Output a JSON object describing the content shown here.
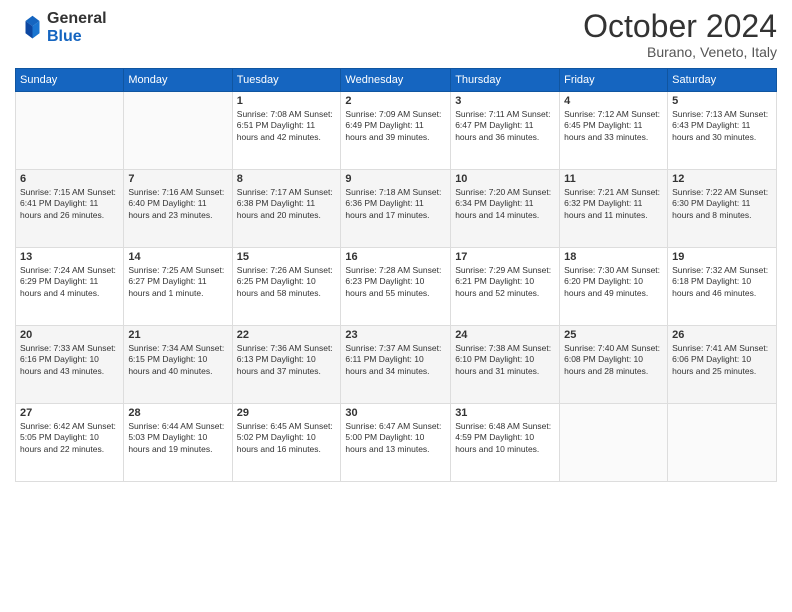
{
  "header": {
    "logo_general": "General",
    "logo_blue": "Blue",
    "month_title": "October 2024",
    "location": "Burano, Veneto, Italy"
  },
  "days_of_week": [
    "Sunday",
    "Monday",
    "Tuesday",
    "Wednesday",
    "Thursday",
    "Friday",
    "Saturday"
  ],
  "weeks": [
    [
      {
        "day": "",
        "info": ""
      },
      {
        "day": "",
        "info": ""
      },
      {
        "day": "1",
        "info": "Sunrise: 7:08 AM\nSunset: 6:51 PM\nDaylight: 11 hours and 42 minutes."
      },
      {
        "day": "2",
        "info": "Sunrise: 7:09 AM\nSunset: 6:49 PM\nDaylight: 11 hours and 39 minutes."
      },
      {
        "day": "3",
        "info": "Sunrise: 7:11 AM\nSunset: 6:47 PM\nDaylight: 11 hours and 36 minutes."
      },
      {
        "day": "4",
        "info": "Sunrise: 7:12 AM\nSunset: 6:45 PM\nDaylight: 11 hours and 33 minutes."
      },
      {
        "day": "5",
        "info": "Sunrise: 7:13 AM\nSunset: 6:43 PM\nDaylight: 11 hours and 30 minutes."
      }
    ],
    [
      {
        "day": "6",
        "info": "Sunrise: 7:15 AM\nSunset: 6:41 PM\nDaylight: 11 hours and 26 minutes."
      },
      {
        "day": "7",
        "info": "Sunrise: 7:16 AM\nSunset: 6:40 PM\nDaylight: 11 hours and 23 minutes."
      },
      {
        "day": "8",
        "info": "Sunrise: 7:17 AM\nSunset: 6:38 PM\nDaylight: 11 hours and 20 minutes."
      },
      {
        "day": "9",
        "info": "Sunrise: 7:18 AM\nSunset: 6:36 PM\nDaylight: 11 hours and 17 minutes."
      },
      {
        "day": "10",
        "info": "Sunrise: 7:20 AM\nSunset: 6:34 PM\nDaylight: 11 hours and 14 minutes."
      },
      {
        "day": "11",
        "info": "Sunrise: 7:21 AM\nSunset: 6:32 PM\nDaylight: 11 hours and 11 minutes."
      },
      {
        "day": "12",
        "info": "Sunrise: 7:22 AM\nSunset: 6:30 PM\nDaylight: 11 hours and 8 minutes."
      }
    ],
    [
      {
        "day": "13",
        "info": "Sunrise: 7:24 AM\nSunset: 6:29 PM\nDaylight: 11 hours and 4 minutes."
      },
      {
        "day": "14",
        "info": "Sunrise: 7:25 AM\nSunset: 6:27 PM\nDaylight: 11 hours and 1 minute."
      },
      {
        "day": "15",
        "info": "Sunrise: 7:26 AM\nSunset: 6:25 PM\nDaylight: 10 hours and 58 minutes."
      },
      {
        "day": "16",
        "info": "Sunrise: 7:28 AM\nSunset: 6:23 PM\nDaylight: 10 hours and 55 minutes."
      },
      {
        "day": "17",
        "info": "Sunrise: 7:29 AM\nSunset: 6:21 PM\nDaylight: 10 hours and 52 minutes."
      },
      {
        "day": "18",
        "info": "Sunrise: 7:30 AM\nSunset: 6:20 PM\nDaylight: 10 hours and 49 minutes."
      },
      {
        "day": "19",
        "info": "Sunrise: 7:32 AM\nSunset: 6:18 PM\nDaylight: 10 hours and 46 minutes."
      }
    ],
    [
      {
        "day": "20",
        "info": "Sunrise: 7:33 AM\nSunset: 6:16 PM\nDaylight: 10 hours and 43 minutes."
      },
      {
        "day": "21",
        "info": "Sunrise: 7:34 AM\nSunset: 6:15 PM\nDaylight: 10 hours and 40 minutes."
      },
      {
        "day": "22",
        "info": "Sunrise: 7:36 AM\nSunset: 6:13 PM\nDaylight: 10 hours and 37 minutes."
      },
      {
        "day": "23",
        "info": "Sunrise: 7:37 AM\nSunset: 6:11 PM\nDaylight: 10 hours and 34 minutes."
      },
      {
        "day": "24",
        "info": "Sunrise: 7:38 AM\nSunset: 6:10 PM\nDaylight: 10 hours and 31 minutes."
      },
      {
        "day": "25",
        "info": "Sunrise: 7:40 AM\nSunset: 6:08 PM\nDaylight: 10 hours and 28 minutes."
      },
      {
        "day": "26",
        "info": "Sunrise: 7:41 AM\nSunset: 6:06 PM\nDaylight: 10 hours and 25 minutes."
      }
    ],
    [
      {
        "day": "27",
        "info": "Sunrise: 6:42 AM\nSunset: 5:05 PM\nDaylight: 10 hours and 22 minutes."
      },
      {
        "day": "28",
        "info": "Sunrise: 6:44 AM\nSunset: 5:03 PM\nDaylight: 10 hours and 19 minutes."
      },
      {
        "day": "29",
        "info": "Sunrise: 6:45 AM\nSunset: 5:02 PM\nDaylight: 10 hours and 16 minutes."
      },
      {
        "day": "30",
        "info": "Sunrise: 6:47 AM\nSunset: 5:00 PM\nDaylight: 10 hours and 13 minutes."
      },
      {
        "day": "31",
        "info": "Sunrise: 6:48 AM\nSunset: 4:59 PM\nDaylight: 10 hours and 10 minutes."
      },
      {
        "day": "",
        "info": ""
      },
      {
        "day": "",
        "info": ""
      }
    ]
  ]
}
